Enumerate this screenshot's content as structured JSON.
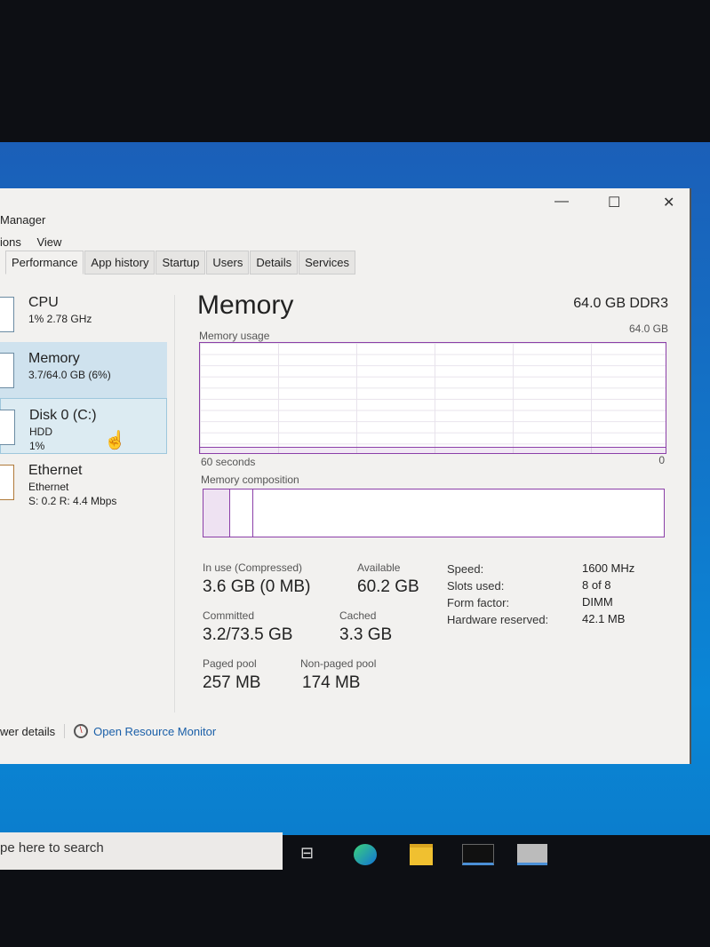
{
  "window": {
    "title": "Manager",
    "controls": {
      "minimize": "—",
      "maximize": "☐",
      "close": "✕"
    }
  },
  "menu": [
    "ions",
    "View"
  ],
  "tabs": [
    "Performance",
    "App history",
    "Startup",
    "Users",
    "Details",
    "Services"
  ],
  "sidebar": [
    {
      "name": "CPU",
      "line1": "1% 2.78 GHz",
      "line2": ""
    },
    {
      "name": "Memory",
      "line1": "3.7/64.0 GB (6%)",
      "line2": ""
    },
    {
      "name": "Disk 0 (C:)",
      "line1": "HDD",
      "line2": "1%"
    },
    {
      "name": "Ethernet",
      "line1": "Ethernet",
      "line2": "S: 0.2 R: 4.4 Mbps"
    }
  ],
  "main": {
    "title": "Memory",
    "spec": "64.0 GB DDR3",
    "usage_label": "Memory usage",
    "usage_max": "64.0 GB",
    "time_label": "60 seconds",
    "usage_min": "0",
    "composition_label": "Memory composition",
    "usage_fraction": 0.06,
    "stats": [
      {
        "label": "In use (Compressed)",
        "value": "3.6 GB (0 MB)"
      },
      {
        "label": "Available",
        "value": "60.2 GB"
      },
      {
        "label": "Committed",
        "value": "3.2/73.5 GB"
      },
      {
        "label": "Cached",
        "value": "3.3 GB"
      },
      {
        "label": "Paged pool",
        "value": "257 MB"
      },
      {
        "label": "Non-paged pool",
        "value": "174 MB"
      }
    ],
    "details": [
      {
        "k": "Speed:",
        "v": "1600 MHz"
      },
      {
        "k": "Slots used:",
        "v": "8 of 8"
      },
      {
        "k": "Form factor:",
        "v": "DIMM"
      },
      {
        "k": "Hardware reserved:",
        "v": "42.1 MB"
      }
    ]
  },
  "footer": {
    "fewer": "wer details",
    "resmon": "Open Resource Monitor"
  },
  "taskbar": {
    "search_placeholder": "pe here to search"
  }
}
